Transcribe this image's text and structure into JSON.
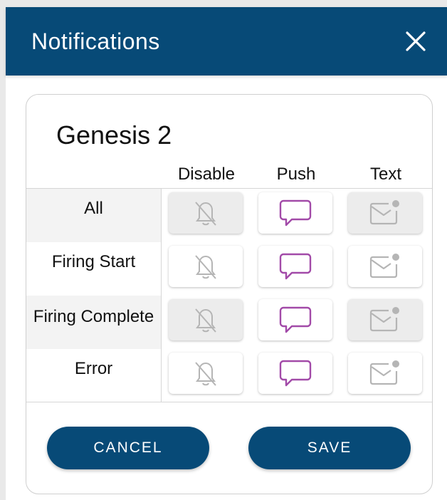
{
  "header": {
    "title": "Notifications"
  },
  "card": {
    "device_name": "Genesis 2",
    "columns": [
      "Disable",
      "Push",
      "Text"
    ],
    "rows": [
      {
        "label": "All"
      },
      {
        "label": "Firing Start"
      },
      {
        "label": "Firing Complete"
      },
      {
        "label": "Error"
      }
    ]
  },
  "footer": {
    "cancel_label": "CANCEL",
    "save_label": "SAVE"
  },
  "colors": {
    "brand": "#074a77",
    "push_accent": "#a24aa8",
    "muted_icon": "#b5b5b5"
  }
}
